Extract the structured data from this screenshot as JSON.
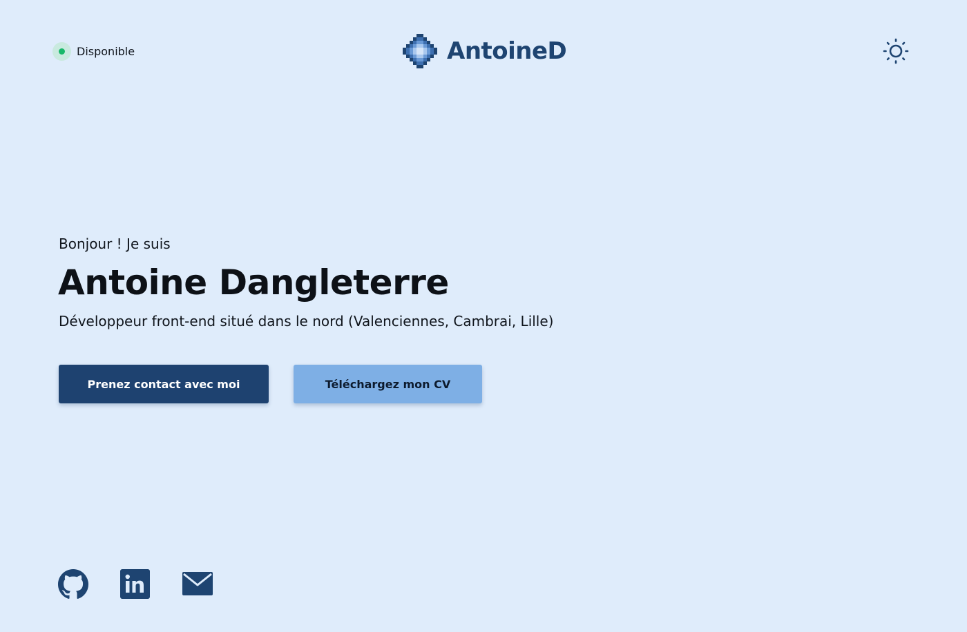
{
  "header": {
    "status_label": "Disponible",
    "logo_text": "AntoineD",
    "theme_toggle_icon": "sun-icon"
  },
  "hero": {
    "greeting": "Bonjour ! Je suis",
    "name": "Antoine Dangleterre",
    "subtitle": "Développeur front-end situé dans le nord (Valenciennes, Cambrai, Lille)",
    "primary_button": "Prenez contact avec moi",
    "secondary_button": "Téléchargez mon CV"
  },
  "social": [
    {
      "icon": "github-icon"
    },
    {
      "icon": "linkedin-icon"
    },
    {
      "icon": "mail-icon"
    }
  ],
  "colors": {
    "background": "#dfecfb",
    "brand": "#1e4271",
    "accent_light": "#7eafe5",
    "status_green": "#19b86a"
  }
}
